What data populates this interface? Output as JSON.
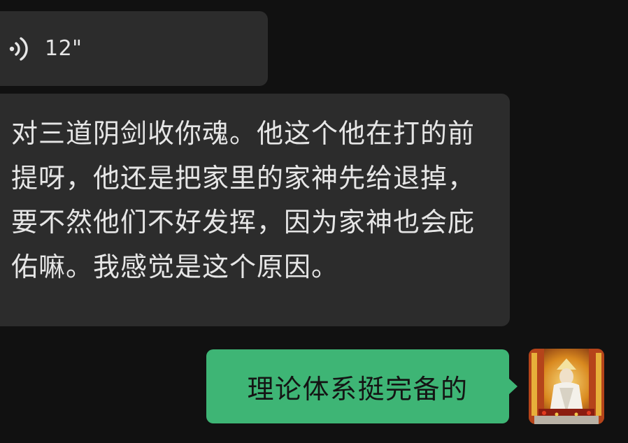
{
  "messages": {
    "voice": {
      "duration": "12\"",
      "icon": "voice-waves-icon"
    },
    "incoming_text": "对三道阴剑收你魂。他这个他在打的前提呀，他还是把家里的家神先给退掉，要不然他们不好发挥，因为家神也会庇佑嘛。我感觉是这个原因。",
    "outgoing_text": "理论体系挺完备的"
  },
  "colors": {
    "background": "#111111",
    "incoming_bubble": "#2c2c2c",
    "outgoing_bubble": "#3eb575",
    "incoming_text": "#e6e6e6",
    "outgoing_text": "#141414"
  }
}
